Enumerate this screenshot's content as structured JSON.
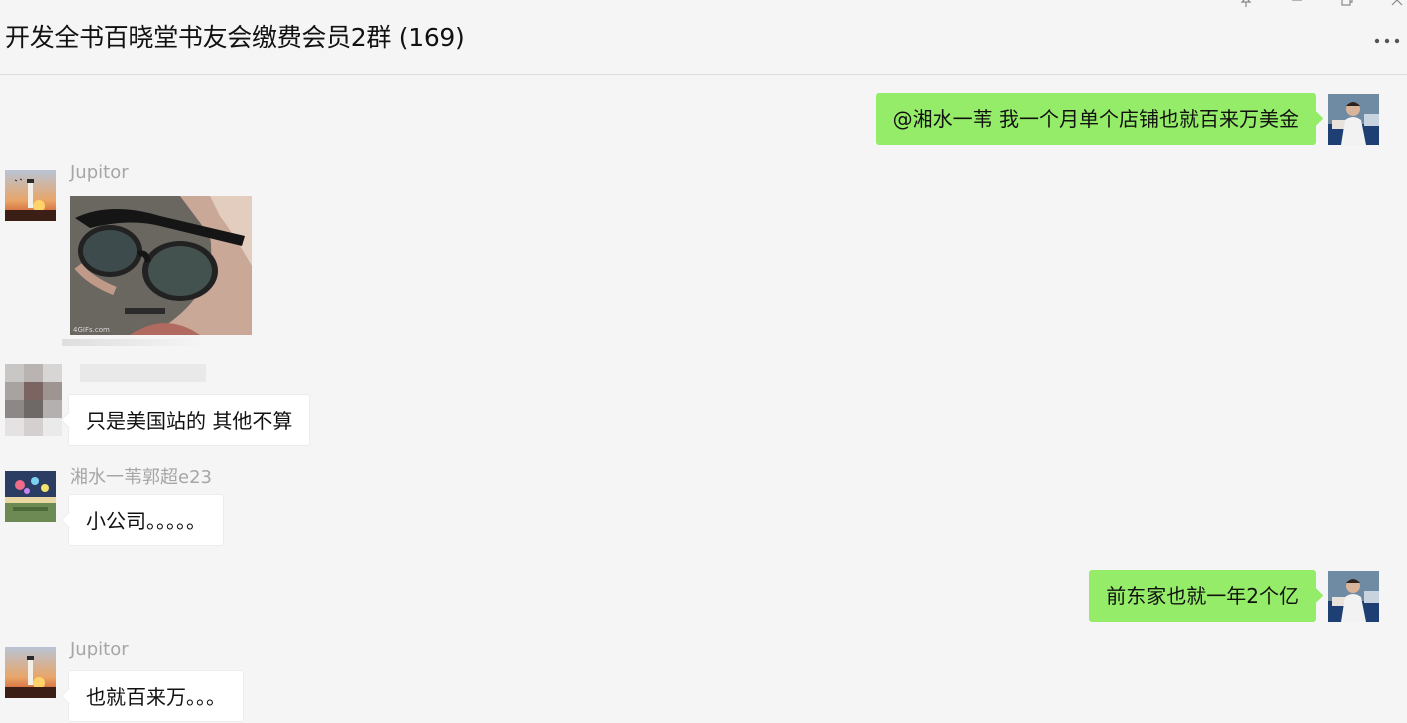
{
  "header": {
    "title": "开发全书百晓堂书友会缴费会员2群 (169)",
    "pin_icon": "pin-icon",
    "minimize_icon": "minimize-icon",
    "restore_icon": "restore-icon",
    "close_icon": "close-icon",
    "more_icon": "more-icon"
  },
  "messages": [
    {
      "side": "out",
      "text": "@湘水一苇 我一个月单个店铺也就百来万美金"
    },
    {
      "side": "in",
      "sender": "Jupitor",
      "type": "image",
      "image_caption": "4GIFs.com"
    },
    {
      "side": "in",
      "sender": "",
      "text": "只是美国站的 其他不算"
    },
    {
      "side": "in",
      "sender": "湘水一苇郭超e23",
      "text": "小公司。。。。。"
    },
    {
      "side": "out",
      "text": "前东家也就一年2个亿"
    },
    {
      "side": "in",
      "sender": "Jupitor",
      "text": "也就百来万。。。"
    }
  ],
  "colors": {
    "outgoing_bubble": "#95ec69",
    "incoming_bubble": "#ffffff",
    "background": "#f5f5f5",
    "nickname": "#a6a6a6"
  }
}
